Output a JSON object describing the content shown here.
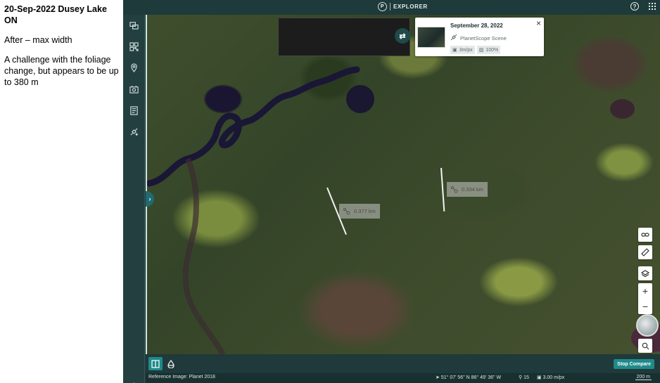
{
  "notes": {
    "title": "20-Sep-2022 Dusey Lake ON",
    "line1": "After – max width",
    "line2": "A challenge with the foliage change, but appears to be up to 380 m"
  },
  "topbar": {
    "logo_glyph": "P",
    "app_name": "EXPLORER",
    "help_icon": "help-icon",
    "apps_icon": "apps-grid-icon"
  },
  "sidenav": {
    "items": [
      {
        "icon": "compare-scenes-icon"
      },
      {
        "icon": "qr-grid-icon"
      },
      {
        "icon": "location-pin-icon"
      },
      {
        "icon": "calendar-camera-icon"
      },
      {
        "icon": "document-list-icon"
      },
      {
        "icon": "satellite-icon"
      }
    ],
    "settings_icon": "gear-icon"
  },
  "scene_card": {
    "date": "September 28, 2022",
    "type": "PlanetScope Scene",
    "resolution": "3m/px",
    "coverage": "100%",
    "close_glyph": "×"
  },
  "measurements": [
    {
      "label": "0.377 km"
    },
    {
      "label": "0.334 km"
    }
  ],
  "controls": {
    "swap_glyph": "⇄",
    "handle_glyph": "›",
    "zoom_in": "+",
    "zoom_out": "−"
  },
  "bottom": {
    "stop_compare": "Stop Compare"
  },
  "status": {
    "reference": "Reference Image: Planet 2018",
    "coordinates": "51° 07' 56\" N 86° 49' 36\" W",
    "zoom_level": "15",
    "resolution": "3.00 m/px",
    "scale": "200 m"
  },
  "colors": {
    "app_bg": "#1f3a3b",
    "accent": "#1f8a8a"
  }
}
